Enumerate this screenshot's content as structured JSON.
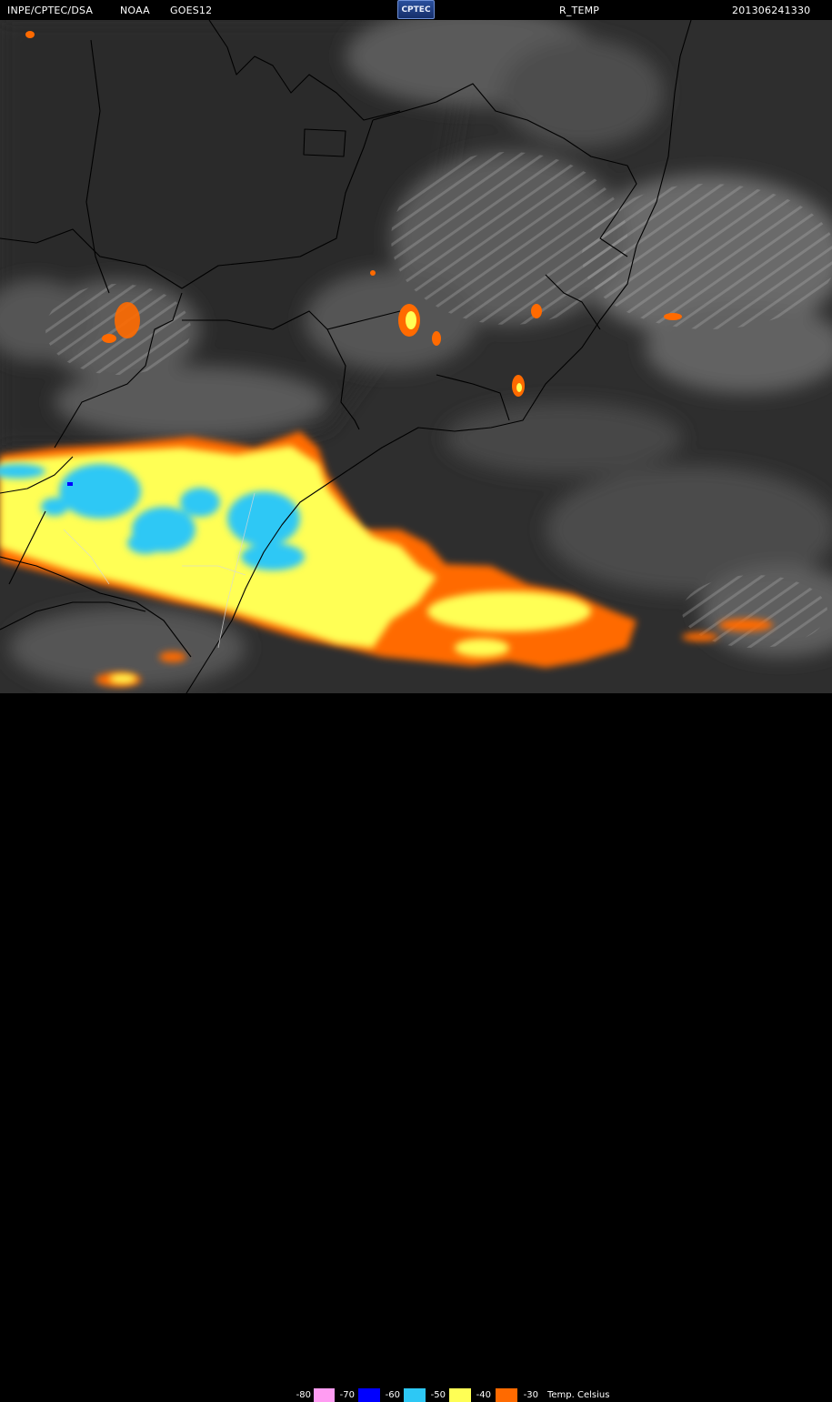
{
  "header": {
    "source": "INPE/CPTEC/DSA",
    "agency": "NOAA",
    "satellite": "GOES12",
    "logo": "CPTEC",
    "product": "R_TEMP",
    "timestamp": "201306241330"
  },
  "legend": {
    "title": "Temp. Celsius",
    "entries": [
      {
        "label": "-80",
        "color": "#ff9cf2"
      },
      {
        "label": "-70",
        "color": "#0000ff"
      },
      {
        "label": "-60",
        "color": "#2dc8f5"
      },
      {
        "label": "-50",
        "color": "#ffff55"
      },
      {
        "label": "-40",
        "color": "#ff6a00"
      },
      {
        "label": "-30",
        "color": "#ff6a00"
      }
    ],
    "chips": [
      {
        "value": "-80",
        "color": "#000000"
      },
      {
        "value": "-70",
        "color": "#ff9cf2"
      },
      {
        "value": "-60",
        "color": "#0000ff"
      },
      {
        "value": "-50",
        "color": "#2dc8f5"
      },
      {
        "value": "-40",
        "color": "#ffff55"
      },
      {
        "value": "-30",
        "color": "#ff6a00"
      }
    ]
  },
  "colors": {
    "background": "#2f2f2f",
    "border_lines": "#000000"
  }
}
